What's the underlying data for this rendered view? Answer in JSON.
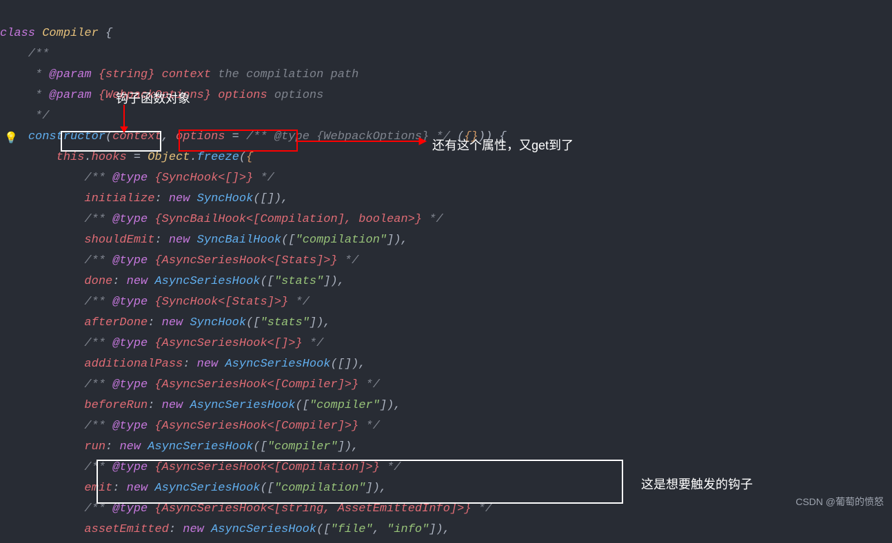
{
  "annotations": {
    "hook_label": "钩子函数对象",
    "freeze_note": "还有这个属性，又get到了",
    "emit_note": "这是想要触发的钩子",
    "watermark": "CSDN @葡萄的愤怒"
  },
  "code": {
    "l1": {
      "kw": "class",
      "cls": " Compiler",
      "pl": " {"
    },
    "l2": {
      "cmt": "    /**"
    },
    "l3": {
      "c": "     * ",
      "tag": "@param",
      "t": " {string} context ",
      "rest": "the compilation path"
    },
    "l4": {
      "c": "     * ",
      "tag": "@param",
      "t": " {WebpackOptions} options ",
      "rest": "options"
    },
    "l5": {
      "c": "     */"
    },
    "l6": {
      "c": "    ",
      "fn": "constructor",
      "p1": "(",
      "prm1": "context",
      "p2": ", ",
      "prm2": "options",
      "p3": " = ",
      "cmt": "/** @type {WebpackOptions} */",
      "p4": " (",
      "br": "{}",
      "p5": ")) {"
    },
    "l7": {
      "c": "        ",
      "this": "this",
      "p1": ".",
      "prop": "hooks",
      "p2": " = ",
      "obj": "Object",
      "p3": ".",
      "fn": "freeze",
      "p4": "(",
      "br": "{"
    },
    "l8": {
      "c": "            ",
      "cmt": "/** ",
      "tag": "@type",
      "t": " {SyncHook<[]>}",
      "cmtend": " */"
    },
    "l9": {
      "c": "            ",
      "prop": "initialize",
      "p1": ": ",
      "kw": "new",
      "p2": " ",
      "fn": "SyncHook",
      "p3": "([]),"
    },
    "l10": {
      "c": "            ",
      "cmt": "/** ",
      "tag": "@type",
      "t": " {SyncBailHook<[Compilation], boolean>}",
      "cmtend": " */"
    },
    "l11": {
      "c": "            ",
      "prop": "shouldEmit",
      "p1": ": ",
      "kw": "new",
      "p2": " ",
      "fn": "SyncBailHook",
      "p3": "([",
      "str": "\"compilation\"",
      "p4": "]),"
    },
    "l12": {
      "c": "            ",
      "cmt": "/** ",
      "tag": "@type",
      "t": " {AsyncSeriesHook<[Stats]>}",
      "cmtend": " */"
    },
    "l13": {
      "c": "            ",
      "prop": "done",
      "p1": ": ",
      "kw": "new",
      "p2": " ",
      "fn": "AsyncSeriesHook",
      "p3": "([",
      "str": "\"stats\"",
      "p4": "]),"
    },
    "l14": {
      "c": "            ",
      "cmt": "/** ",
      "tag": "@type",
      "t": " {SyncHook<[Stats]>}",
      "cmtend": " */"
    },
    "l15": {
      "c": "            ",
      "prop": "afterDone",
      "p1": ": ",
      "kw": "new",
      "p2": " ",
      "fn": "SyncHook",
      "p3": "([",
      "str": "\"stats\"",
      "p4": "]),"
    },
    "l16": {
      "c": "            ",
      "cmt": "/** ",
      "tag": "@type",
      "t": " {AsyncSeriesHook<[]>}",
      "cmtend": " */"
    },
    "l17": {
      "c": "            ",
      "prop": "additionalPass",
      "p1": ": ",
      "kw": "new",
      "p2": " ",
      "fn": "AsyncSeriesHook",
      "p3": "([]),"
    },
    "l18": {
      "c": "            ",
      "cmt": "/** ",
      "tag": "@type",
      "t": " {AsyncSeriesHook<[Compiler]>}",
      "cmtend": " */"
    },
    "l19": {
      "c": "            ",
      "prop": "beforeRun",
      "p1": ": ",
      "kw": "new",
      "p2": " ",
      "fn": "AsyncSeriesHook",
      "p3": "([",
      "str": "\"compiler\"",
      "p4": "]),"
    },
    "l20": {
      "c": "            ",
      "cmt": "/** ",
      "tag": "@type",
      "t": " {AsyncSeriesHook<[Compiler]>}",
      "cmtend": " */"
    },
    "l21": {
      "c": "            ",
      "prop": "run",
      "p1": ": ",
      "kw": "new",
      "p2": " ",
      "fn": "AsyncSeriesHook",
      "p3": "([",
      "str": "\"compiler\"",
      "p4": "]),"
    },
    "l22": {
      "c": "            ",
      "cmt": "/** ",
      "tag": "@type",
      "t": " {AsyncSeriesHook<[Compilation]>}",
      "cmtend": " */"
    },
    "l23": {
      "c": "            ",
      "prop": "emit",
      "p1": ": ",
      "kw": "new",
      "p2": " ",
      "fn": "AsyncSeriesHook",
      "p3": "([",
      "str": "\"compilation\"",
      "p4": "]),"
    },
    "l24": {
      "c": "            ",
      "cmt": "/** ",
      "tag": "@type",
      "t": " {AsyncSeriesHook<[string, AssetEmittedInfo]>}",
      "cmtend": " */"
    },
    "l25": {
      "c": "            ",
      "prop": "assetEmitted",
      "p1": ": ",
      "kw": "new",
      "p2": " ",
      "fn": "AsyncSeriesHook",
      "p3": "([",
      "str1": "\"file\"",
      "p4": ", ",
      "str2": "\"info\"",
      "p5": "]),"
    }
  }
}
